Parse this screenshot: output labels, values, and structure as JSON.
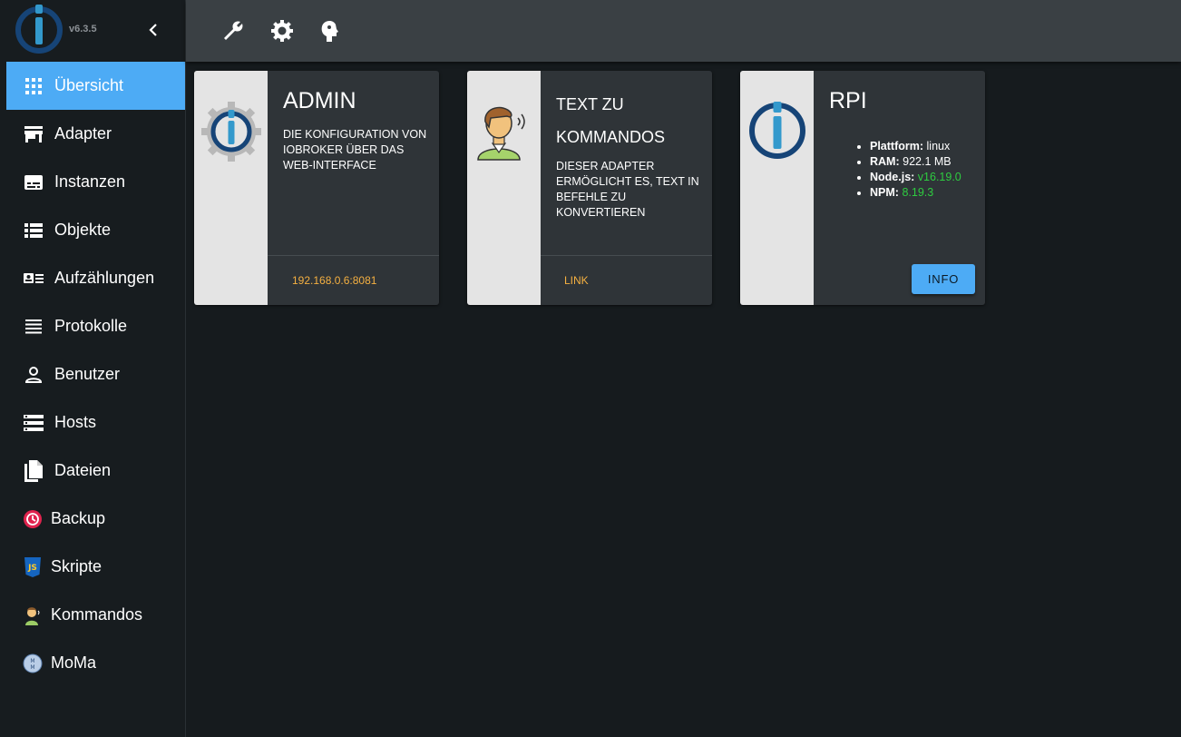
{
  "sidebar": {
    "version": "v6.3.5",
    "items": [
      {
        "label": "Übersicht",
        "icon": "grid-icon"
      },
      {
        "label": "Adapter",
        "icon": "store-icon"
      },
      {
        "label": "Instanzen",
        "icon": "subtitles-icon"
      },
      {
        "label": "Objekte",
        "icon": "list-icon"
      },
      {
        "label": "Aufzählungen",
        "icon": "enum-icon"
      },
      {
        "label": "Protokolle",
        "icon": "lines-icon"
      },
      {
        "label": "Benutzer",
        "icon": "person-icon"
      },
      {
        "label": "Hosts",
        "icon": "storage-icon"
      },
      {
        "label": "Dateien",
        "icon": "files-icon"
      },
      {
        "label": "Backup",
        "icon": "backup-icon"
      },
      {
        "label": "Skripte",
        "icon": "javascript-icon"
      },
      {
        "label": "Kommandos",
        "icon": "speaker-person-icon"
      },
      {
        "label": "MoMa",
        "icon": "moma-icon"
      }
    ]
  },
  "topbar": {
    "buttons": [
      "wrench-icon",
      "gear-icon",
      "head-icon"
    ]
  },
  "cards": [
    {
      "title": "ADMIN",
      "description": "Die Konfiguration von ioBroker über das Web-Interface",
      "link": "192.168.0.6:8081"
    },
    {
      "title_line1": "TEXT ZU",
      "title_line2": "KOMMANDOS",
      "description": "Dieser Adapter ermöglicht es, Text in Befehle zu konvertieren",
      "link": "LINK"
    },
    {
      "title": "RPI",
      "info": {
        "platform_label": "Plattform:",
        "platform_value": "linux",
        "ram_label": "RAM:",
        "ram_value": "922.1 MB",
        "node_label": "Node.js:",
        "node_value": "v16.19.0",
        "npm_label": "NPM:",
        "npm_value": "8.19.3"
      },
      "button": "INFO"
    }
  ],
  "colors": {
    "accent": "#4dabf5",
    "link": "#f5b041",
    "version_green": "#2ecc40"
  }
}
